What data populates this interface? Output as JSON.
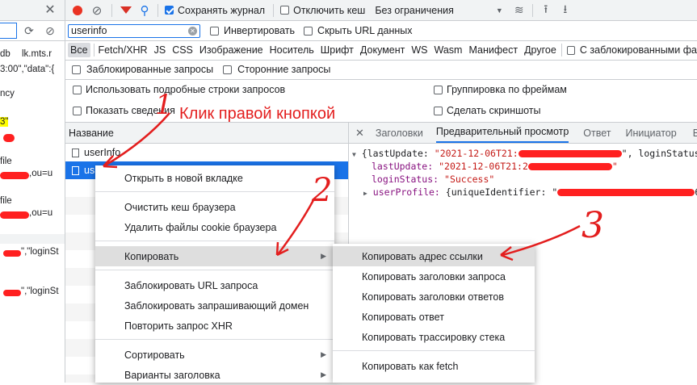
{
  "toolbar": {
    "preserve_log": "Сохранять журнал",
    "disable_cache": "Отключить кеш",
    "throttling": "Без ограничения"
  },
  "filter": {
    "value": "userinfo",
    "invert": "Инвертировать",
    "hide_urls": "Скрыть URL данных"
  },
  "types": [
    "Все",
    "Fetch/XHR",
    "JS",
    "CSS",
    "Изображение",
    "Носитель",
    "Шрифт",
    "Документ",
    "WS",
    "Wasm",
    "Манифест",
    "Другое"
  ],
  "blocked_cookies": "С заблокированными фа",
  "options": {
    "blocked_requests": "Заблокированные запросы",
    "third_party": "Сторонние запросы",
    "big_rows": "Использовать подробные строки запросов",
    "overview": "Показать сведения",
    "group_frames": "Группировка по фреймам",
    "screenshots": "Сделать скриншоты"
  },
  "left_console": {
    "lines": [
      "db",
      "lk.mts.r",
      "3:00\",\"data\":{",
      "ncy",
      "3\"",
      ".",
      "file",
      ",ou=u",
      "file",
      ",ou=u",
      "\",\"loginSt",
      "\",\"loginSt"
    ]
  },
  "request_list": {
    "header": "Название",
    "rows": [
      "userInfo",
      "us"
    ]
  },
  "detail_tabs": [
    "Заголовки",
    "Предварительный просмотр",
    "Ответ",
    "Инициатор",
    "В"
  ],
  "preview": {
    "line1_key": "{lastUpdate: ",
    "line1_val": "\"2021-12-06T21:",
    "line1_tail": "\", loginStatus: ",
    "line2_key": "lastUpdate: ",
    "line2_val": "\"2021-12-06T21:2",
    "line3_key": "loginStatus: ",
    "line3_val": "\"Success\"",
    "line4_key": "userProfile: ",
    "line4_val": "{uniqueIdentifier: \"",
    "line4_tail": "6"
  },
  "context_menu": {
    "open_new_tab": "Открыть в новой вкладке",
    "clear_cache": "Очистить кеш браузера",
    "clear_cookies": "Удалить файлы cookie браузера",
    "copy": "Копировать",
    "block_url": "Заблокировать URL запроса",
    "block_domain": "Заблокировать запрашивающий домен",
    "replay_xhr": "Повторить запрос XHR",
    "sort": "Сортировать",
    "header_options": "Варианты заголовка"
  },
  "copy_submenu": {
    "copy_link": "Копировать адрес ссылки",
    "copy_req_headers": "Копировать заголовки запроса",
    "copy_resp_headers": "Копировать заголовки ответов",
    "copy_response": "Копировать ответ",
    "copy_stack": "Копировать трассировку стека",
    "copy_fetch": "Копировать как fetch"
  },
  "annotation": {
    "n1": "1",
    "text": "Клик правой кнопкой",
    "n2": "2",
    "n3": "3"
  },
  "colors": {
    "accent": "#1a73e8",
    "annotation_red": "#e31e1e",
    "selected_row": "#1a73e8"
  }
}
